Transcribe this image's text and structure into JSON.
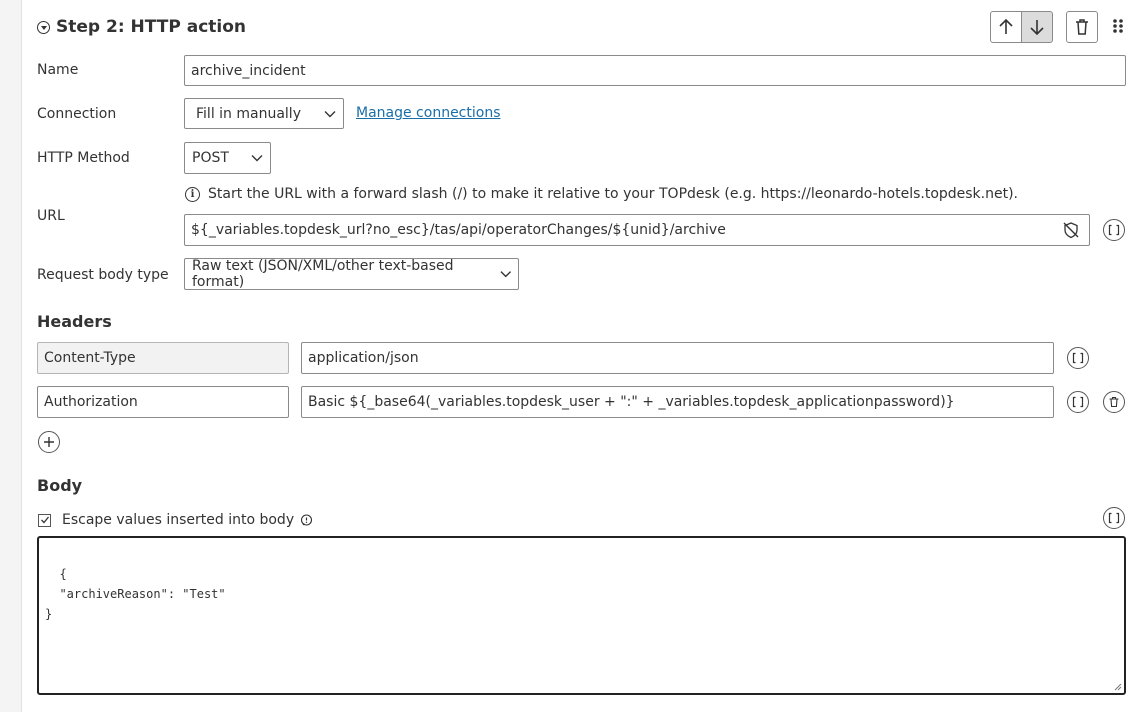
{
  "step": {
    "title": "Step 2: HTTP action"
  },
  "fields": {
    "name": {
      "label": "Name",
      "value": "archive_incident"
    },
    "connection": {
      "label": "Connection",
      "selected": "Fill in manually",
      "manage_link": "Manage connections"
    },
    "method": {
      "label": "HTTP Method",
      "selected": "POST"
    },
    "url": {
      "label": "URL",
      "hint": "Start the URL with a forward slash (/) to make it relative to your TOPdesk (e.g. https://leonardo-hotels.topdesk.net).",
      "value": "${_variables.topdesk_url?no_esc}/tas/api/operatorChanges/${unid}/archive"
    },
    "body_type": {
      "label": "Request body type",
      "selected": "Raw text (JSON/XML/other text-based format)"
    }
  },
  "headers": {
    "title": "Headers",
    "rows": [
      {
        "key": "Content-Type",
        "value": "application/json"
      },
      {
        "key": "Authorization",
        "value": "Basic ${_base64(_variables.topdesk_user + \":\" + _variables.topdesk_applicationpassword)}"
      }
    ]
  },
  "body": {
    "title": "Body",
    "escape_label": "Escape values inserted into body",
    "escape_checked": true,
    "content": "{\n  \"archiveReason\": \"Test\"\n}"
  },
  "icons": {
    "move_up": "arrow-up-icon",
    "move_down": "arrow-down-icon",
    "delete": "trash-icon",
    "drag": "drag-handle-icon",
    "variables": "brackets-icon",
    "add": "plus-icon",
    "info": "info-icon",
    "visibility": "eye-off-icon"
  },
  "colors": {
    "link": "#1a6ea8",
    "pressed_button": "#dcdcdc"
  }
}
